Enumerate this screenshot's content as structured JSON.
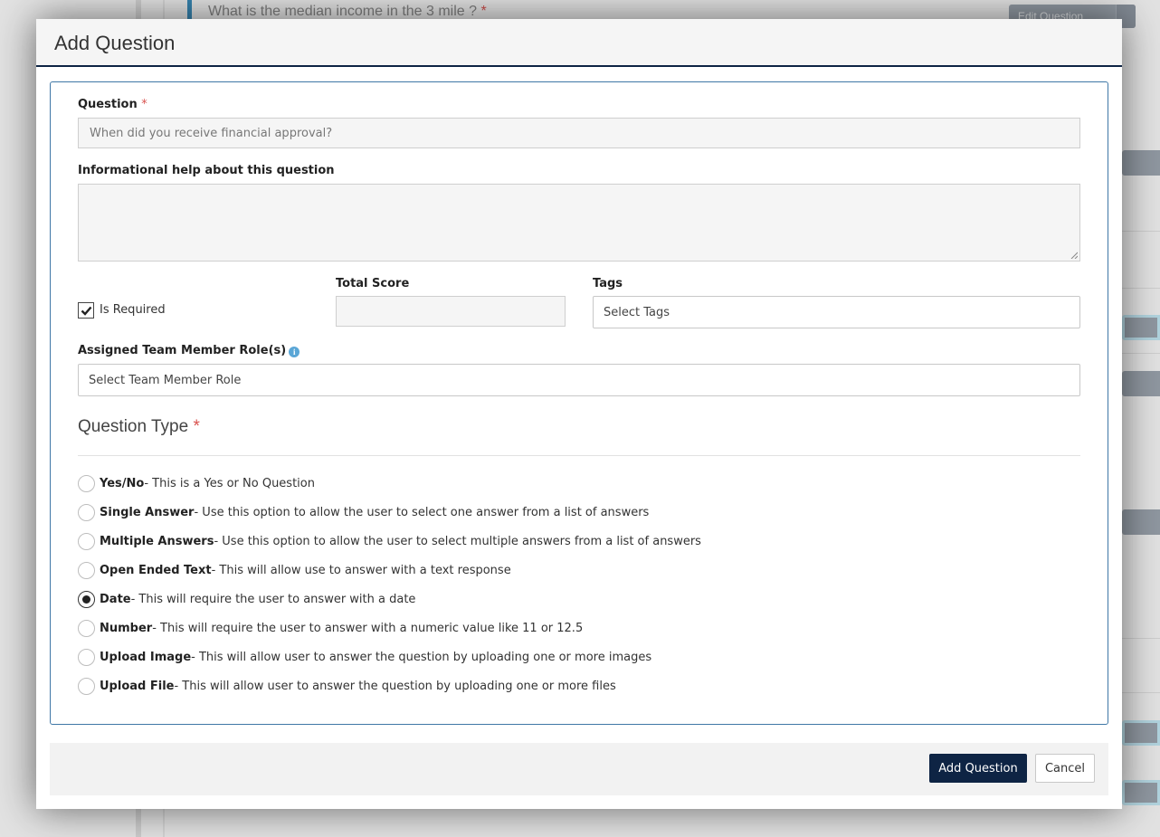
{
  "background": {
    "question_text": "What is the median income in the 3 mile ?",
    "required_mark": "*",
    "edit_button_label": "Edit Question"
  },
  "modal": {
    "title": "Add Question",
    "question_label": "Question",
    "required_mark": "*",
    "question_placeholder": "When did you receive financial approval?",
    "help_label": "Informational help about this question",
    "help_value": "",
    "is_required_label": "Is Required",
    "is_required_checked": true,
    "total_score_label": "Total Score",
    "total_score_value": "",
    "tags_label": "Tags",
    "tags_placeholder": "Select Tags",
    "roles_label": "Assigned Team Member Role(s)",
    "roles_placeholder": "Select Team Member Role",
    "question_type_title": "Question Type",
    "question_types": [
      {
        "name": "Yes/No",
        "desc": " - This is a Yes or No Question",
        "checked": false
      },
      {
        "name": "Single Answer",
        "desc": " - Use this option to allow the user to select one answer from a list of answers",
        "checked": false
      },
      {
        "name": "Multiple Answers",
        "desc": " - Use this option to allow the user to select multiple answers from a list of answers",
        "checked": false
      },
      {
        "name": "Open Ended Text",
        "desc": " - This will allow use to answer with a text response",
        "checked": false
      },
      {
        "name": "Date",
        "desc": " - This will require the user to answer with a date",
        "checked": true
      },
      {
        "name": "Number",
        "desc": " - This will require the user to answer with a numeric value like 11 or 12.5",
        "checked": false
      },
      {
        "name": "Upload Image",
        "desc": " - This will allow user to answer the question by uploading one or more images",
        "checked": false
      },
      {
        "name": "Upload File",
        "desc": " - This will allow user to answer the question by uploading one or more files",
        "checked": false
      }
    ],
    "add_button_label": "Add Question",
    "cancel_button_label": "Cancel"
  },
  "colors": {
    "primary": "#0e2444",
    "panel_border": "#3f77a6",
    "required": "#d9534f",
    "info": "#5aa6d6"
  }
}
